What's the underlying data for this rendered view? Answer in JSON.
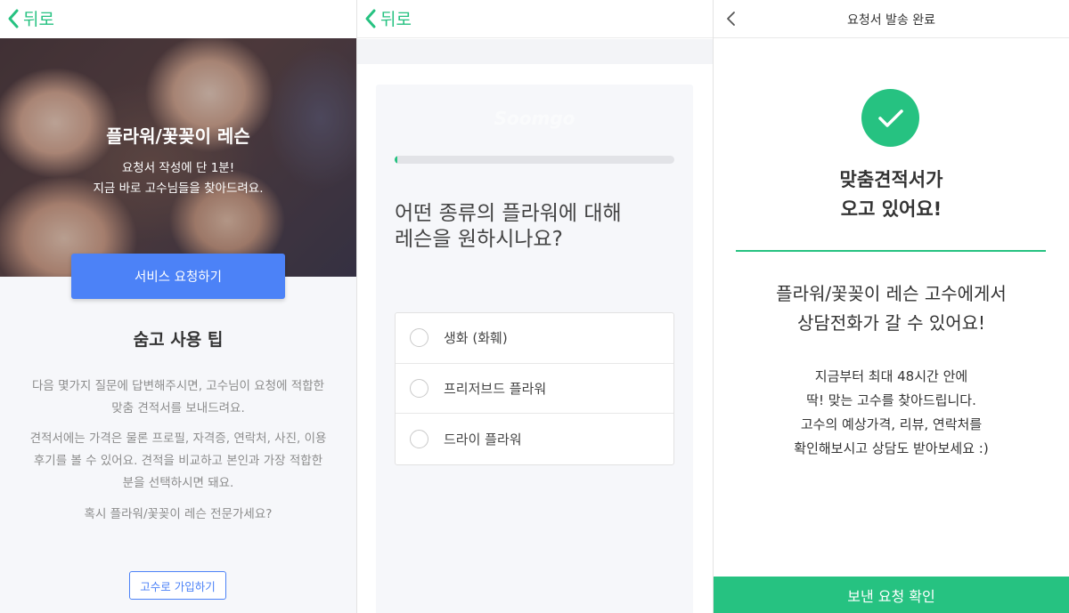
{
  "panel1": {
    "back_label": "뒤로",
    "hero_title": "플라워/꽃꽂이 레슨",
    "hero_line1": "요청서 작성에 단 1분!",
    "hero_line2": "지금 바로 고수님들을 찾아드려요.",
    "service_button": "서비스 요청하기",
    "tip_heading": "숨고 사용 팁",
    "tip_para1_line1": "다음 몇가지 질문에 답변해주시면, 고수님이 요청에 적합한",
    "tip_para1_line2": "맞춤 견적서를 보내드려요.",
    "tip_para2_line1": "견적서에는 가격은 물론 프로필, 자격증, 연락처, 사진, 이용",
    "tip_para2_line2": "후기를 볼 수 있어요. 견적을 비교하고 본인과 가장 적합한",
    "tip_para2_line3": "분을 선택하시면 돼요.",
    "expert_question": "혹시 플라워/꽃꽂이 레슨 전문가세요?",
    "join_button": "고수로 가입하기"
  },
  "panel2": {
    "back_label": "뒤로",
    "watermark": "Soomgo",
    "progress_fraction": 0.01,
    "question_line1": "어떤 종류의 플라워에 대해",
    "question_line2": "레슨을 원하시나요?",
    "options": [
      {
        "label": "생화 (화훼)"
      },
      {
        "label": "프리저브드 플라워"
      },
      {
        "label": "드라이 플라워"
      }
    ]
  },
  "panel3": {
    "header_title": "요청서 발송 완료",
    "success_line1": "맞춤견적서가",
    "success_line2": "오고 있어요!",
    "call_line1": "플라워/꽃꽂이 레슨 고수에게서",
    "call_line2": "상담전화가 갈 수 있어요!",
    "info_line1": "지금부터 최대 48시간 안에",
    "info_line2": "딱! 맞는 고수를 찾아드립니다.",
    "info_line3": "고수의 예상가격, 리뷰, 연락처를",
    "info_line4": "확인해보시고 상담도 받아보세요 :)",
    "confirm_button": "보낸 요청 확인"
  },
  "colors": {
    "accent_green": "#26c281",
    "primary_blue": "#4c82f7",
    "muted_text": "#8c8c8c"
  },
  "icons": [
    "chevron-left-icon",
    "checkmark-icon",
    "radio-unchecked-icon"
  ]
}
